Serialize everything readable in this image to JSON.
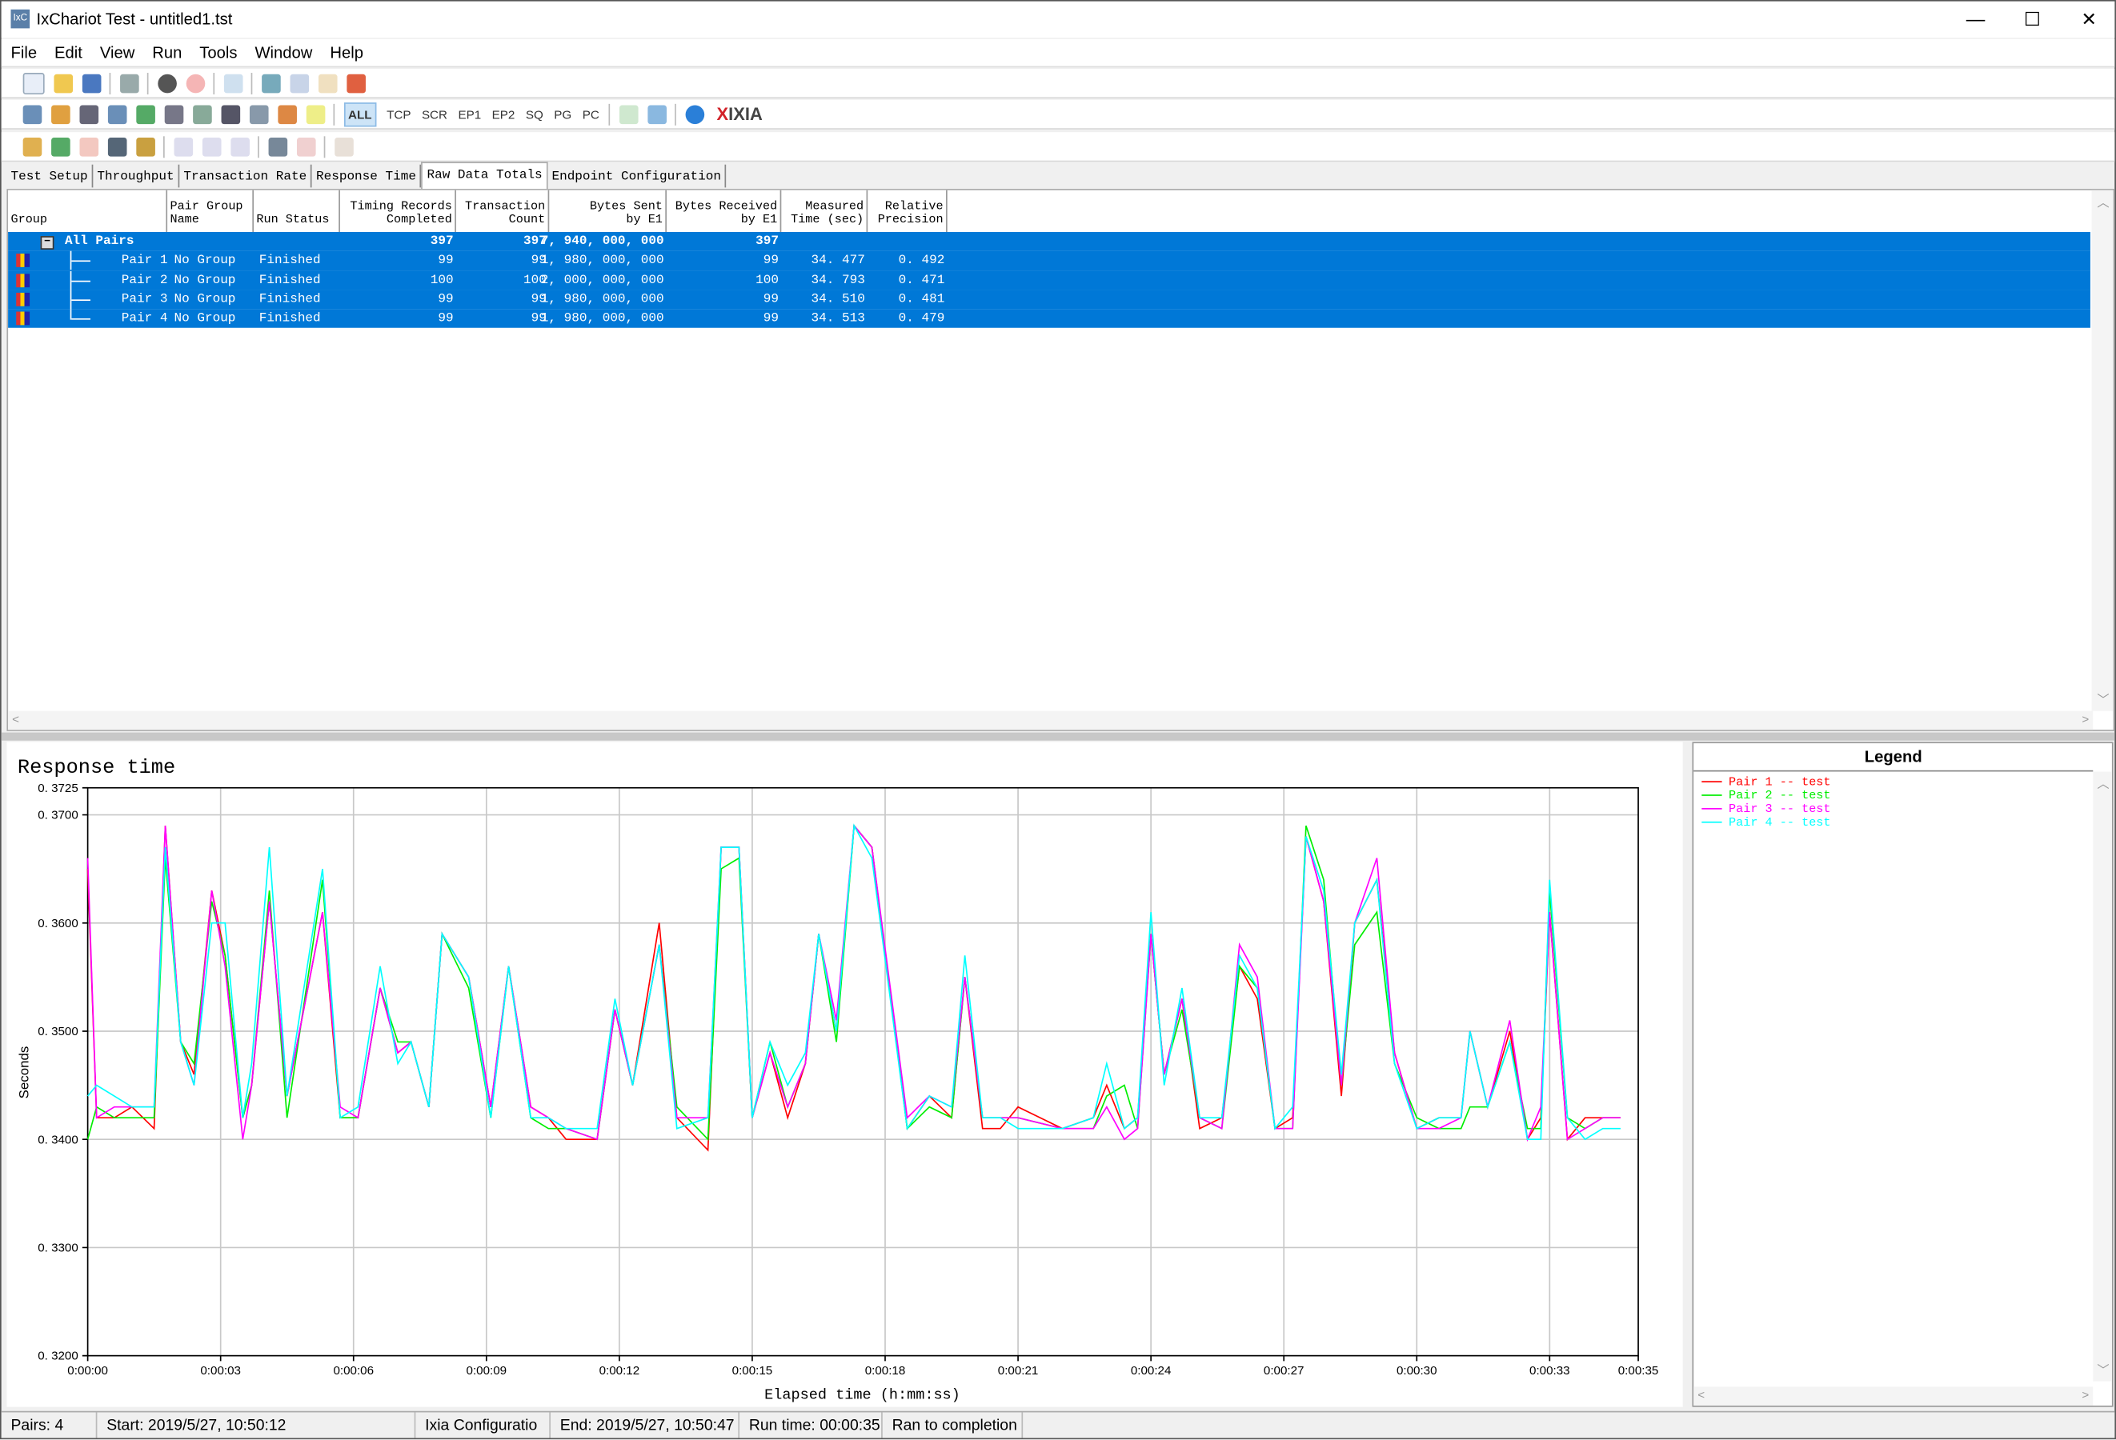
{
  "window": {
    "title": "IxChariot Test - untitled1.tst",
    "app_icon": "IxC",
    "minimize": "—",
    "maximize": "☐",
    "close": "✕"
  },
  "menu": [
    "File",
    "Edit",
    "View",
    "Run",
    "Tools",
    "Window",
    "Help"
  ],
  "toolbar2_labels": [
    "ALL",
    "TCP",
    "SCR",
    "EP1",
    "EP2",
    "SQ",
    "PG",
    "PC"
  ],
  "brand": {
    "x": "X",
    "name": "IXIA"
  },
  "tabs": [
    "Test Setup",
    "Throughput",
    "Transaction Rate",
    "Response Time",
    "Raw Data Totals",
    "Endpoint Configuration"
  ],
  "active_tab": "Raw Data Totals",
  "table": {
    "columns": [
      "Group",
      "Pair Group\nName",
      "Run Status",
      "Timing Records\nCompleted",
      "Transaction\nCount",
      "Bytes Sent\nby E1",
      "Bytes Received\nby E1",
      "Measured\nTime (sec)",
      "Relative\nPrecision"
    ],
    "summary": {
      "group": "All Pairs",
      "expander": "−",
      "timing": "397",
      "transactions": "397",
      "bytes_sent": "7, 940, 000, 000",
      "bytes_received": "397"
    },
    "rows": [
      {
        "group": "Pair 1",
        "pair_group": "No Group",
        "status": "Finished",
        "timing": "99",
        "transactions": "99",
        "bytes_sent": "1, 980, 000, 000",
        "bytes_received": "99",
        "measured": "34. 477",
        "precision": "0. 492"
      },
      {
        "group": "Pair 2",
        "pair_group": "No Group",
        "status": "Finished",
        "timing": "100",
        "transactions": "100",
        "bytes_sent": "2, 000, 000, 000",
        "bytes_received": "100",
        "measured": "34. 793",
        "precision": "0. 471"
      },
      {
        "group": "Pair 3",
        "pair_group": "No Group",
        "status": "Finished",
        "timing": "99",
        "transactions": "99",
        "bytes_sent": "1, 980, 000, 000",
        "bytes_received": "99",
        "measured": "34. 510",
        "precision": "0. 481"
      },
      {
        "group": "Pair 4",
        "pair_group": "No Group",
        "status": "Finished",
        "timing": "99",
        "transactions": "99",
        "bytes_sent": "1, 980, 000, 000",
        "bytes_received": "99",
        "measured": "34. 513",
        "precision": "0. 479"
      }
    ],
    "selection_color": "#0078d7"
  },
  "legend": {
    "title": "Legend"
  },
  "chart_data": {
    "type": "line",
    "title": "Response time",
    "xlabel": "Elapsed time (h:mm:ss)",
    "ylabel": "Seconds",
    "xlim": [
      0,
      35
    ],
    "ylim": [
      0.32,
      0.3725
    ],
    "grid": true,
    "legend_placement": "right-panel",
    "x_ticks": [
      0,
      3,
      6,
      9,
      12,
      15,
      18,
      21,
      24,
      27,
      30,
      33,
      35
    ],
    "x_tick_labels": [
      "0:00:00",
      "0:00:03",
      "0:00:06",
      "0:00:09",
      "0:00:12",
      "0:00:15",
      "0:00:18",
      "0:00:21",
      "0:00:24",
      "0:00:27",
      "0:00:30",
      "0:00:33",
      "0:00:35"
    ],
    "y_ticks": [
      0.32,
      0.33,
      0.34,
      0.35,
      0.36,
      0.37,
      0.3725
    ],
    "y_tick_labels": [
      "0. 3200",
      "0. 3300",
      "0. 3400",
      "0. 3500",
      "0. 3600",
      "0. 3700",
      "0. 3725"
    ],
    "x": [
      0,
      0.2,
      0.6,
      1.0,
      1.5,
      1.75,
      2.1,
      2.4,
      2.8,
      3.1,
      3.5,
      3.7,
      4.1,
      4.5,
      5.3,
      5.7,
      6.1,
      6.6,
      7.0,
      7.3,
      7.7,
      8.0,
      8.6,
      9.1,
      9.5,
      10.0,
      10.4,
      10.8,
      11.5,
      11.9,
      12.3,
      12.9,
      13.3,
      14.0,
      14.3,
      14.7,
      15.0,
      15.4,
      15.8,
      16.2,
      16.5,
      16.9,
      17.3,
      17.7,
      18.5,
      19.0,
      19.5,
      19.8,
      20.2,
      20.6,
      21.0,
      22.0,
      22.7,
      23.0,
      23.4,
      23.7,
      24.0,
      24.3,
      24.7,
      25.1,
      25.6,
      26.0,
      26.4,
      26.8,
      27.2,
      27.5,
      27.9,
      28.3,
      28.6,
      29.1,
      29.5,
      30.0,
      30.5,
      31.0,
      31.2,
      31.6,
      32.1,
      32.5,
      32.8,
      33.0,
      33.4,
      33.8,
      34.2,
      34.6
    ],
    "series": [
      {
        "name": "Pair 1 -- test",
        "color": "#ff0000",
        "values": [
          0.365,
          0.342,
          0.342,
          0.343,
          0.341,
          0.369,
          0.349,
          0.346,
          0.363,
          0.357,
          0.342,
          0.345,
          0.362,
          0.344,
          0.361,
          0.342,
          0.342,
          0.354,
          0.348,
          0.349,
          0.343,
          0.359,
          0.355,
          0.343,
          0.356,
          0.343,
          0.342,
          0.34,
          0.34,
          0.352,
          0.345,
          0.36,
          0.342,
          0.339,
          0.367,
          0.367,
          0.342,
          0.348,
          0.342,
          0.347,
          0.359,
          0.35,
          0.369,
          0.367,
          0.341,
          0.344,
          0.342,
          0.355,
          0.341,
          0.341,
          0.343,
          0.341,
          0.342,
          0.345,
          0.341,
          0.342,
          0.359,
          0.346,
          0.353,
          0.341,
          0.342,
          0.356,
          0.353,
          0.341,
          0.342,
          0.368,
          0.362,
          0.344,
          0.36,
          0.364,
          0.348,
          0.341,
          0.342,
          0.342,
          0.35,
          0.343,
          0.35,
          0.34,
          0.342,
          0.361,
          0.34,
          0.342,
          0.342,
          0.342
        ]
      },
      {
        "name": "Pair 2 -- test",
        "color": "#00ee00",
        "values": [
          0.34,
          0.343,
          0.342,
          0.342,
          0.342,
          0.366,
          0.349,
          0.347,
          0.362,
          0.357,
          0.342,
          0.345,
          0.363,
          0.342,
          0.364,
          0.342,
          0.342,
          0.354,
          0.349,
          0.349,
          0.343,
          0.359,
          0.354,
          0.342,
          0.356,
          0.342,
          0.341,
          0.341,
          0.34,
          0.352,
          0.345,
          0.358,
          0.343,
          0.34,
          0.365,
          0.366,
          0.342,
          0.349,
          0.343,
          0.347,
          0.359,
          0.349,
          0.369,
          0.367,
          0.341,
          0.343,
          0.342,
          0.355,
          0.342,
          0.342,
          0.342,
          0.341,
          0.341,
          0.344,
          0.345,
          0.341,
          0.359,
          0.346,
          0.352,
          0.342,
          0.341,
          0.356,
          0.354,
          0.341,
          0.341,
          0.369,
          0.364,
          0.345,
          0.358,
          0.361,
          0.347,
          0.342,
          0.341,
          0.341,
          0.343,
          0.343,
          0.349,
          0.341,
          0.341,
          0.363,
          0.342,
          0.341,
          0.342,
          0.342
        ]
      },
      {
        "name": "Pair 3 -- test",
        "color": "#ff00ff",
        "values": [
          0.366,
          0.342,
          0.343,
          0.343,
          0.343,
          0.369,
          0.349,
          0.345,
          0.363,
          0.356,
          0.34,
          0.345,
          0.362,
          0.344,
          0.361,
          0.343,
          0.342,
          0.354,
          0.348,
          0.349,
          0.343,
          0.359,
          0.355,
          0.343,
          0.356,
          0.343,
          0.342,
          0.341,
          0.34,
          0.352,
          0.345,
          0.358,
          0.342,
          0.342,
          0.367,
          0.367,
          0.342,
          0.348,
          0.343,
          0.347,
          0.359,
          0.351,
          0.369,
          0.367,
          0.342,
          0.344,
          0.343,
          0.355,
          0.342,
          0.342,
          0.342,
          0.341,
          0.341,
          0.343,
          0.34,
          0.341,
          0.359,
          0.346,
          0.353,
          0.342,
          0.341,
          0.358,
          0.355,
          0.341,
          0.341,
          0.368,
          0.362,
          0.345,
          0.36,
          0.366,
          0.348,
          0.341,
          0.341,
          0.342,
          0.35,
          0.343,
          0.351,
          0.34,
          0.343,
          0.361,
          0.34,
          0.341,
          0.342,
          0.342
        ]
      },
      {
        "name": "Pair 4 -- test",
        "color": "#00ffff",
        "values": [
          0.344,
          0.345,
          0.344,
          0.343,
          0.343,
          0.367,
          0.349,
          0.345,
          0.36,
          0.36,
          0.342,
          0.347,
          0.367,
          0.344,
          0.365,
          0.342,
          0.343,
          0.356,
          0.347,
          0.349,
          0.343,
          0.359,
          0.355,
          0.342,
          0.356,
          0.342,
          0.342,
          0.341,
          0.341,
          0.353,
          0.345,
          0.358,
          0.341,
          0.342,
          0.367,
          0.367,
          0.342,
          0.349,
          0.345,
          0.348,
          0.359,
          0.35,
          0.369,
          0.366,
          0.341,
          0.344,
          0.343,
          0.357,
          0.342,
          0.342,
          0.341,
          0.341,
          0.342,
          0.347,
          0.341,
          0.342,
          0.361,
          0.345,
          0.354,
          0.342,
          0.342,
          0.357,
          0.354,
          0.341,
          0.343,
          0.368,
          0.363,
          0.346,
          0.36,
          0.364,
          0.347,
          0.341,
          0.342,
          0.342,
          0.35,
          0.343,
          0.349,
          0.34,
          0.34,
          0.364,
          0.342,
          0.34,
          0.341,
          0.341
        ]
      }
    ]
  },
  "status": {
    "pairs": "Pairs: 4",
    "start": "Start: 2019/5/27, 10:50:12",
    "config": "Ixia Configuratio",
    "end": "End: 2019/5/27, 10:50:47",
    "run_time": "Run time: 00:00:35",
    "result": "Ran to completion"
  }
}
